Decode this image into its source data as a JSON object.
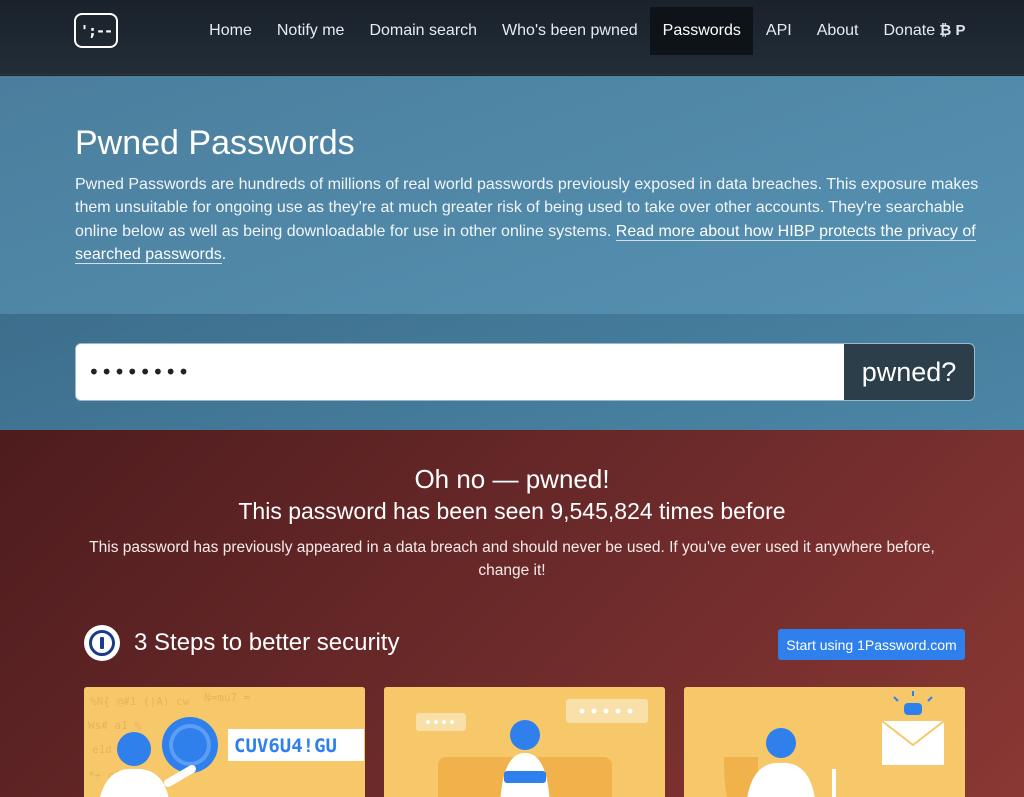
{
  "nav": {
    "logo_text": "';--",
    "items": [
      {
        "label": "Home"
      },
      {
        "label": "Notify me"
      },
      {
        "label": "Domain search"
      },
      {
        "label": "Who's been pwned"
      },
      {
        "label": "Passwords",
        "active": true
      },
      {
        "label": "API"
      },
      {
        "label": "About"
      },
      {
        "label": "Donate",
        "suffix": "₿ P"
      }
    ]
  },
  "hero": {
    "title": "Pwned Passwords",
    "text": "Pwned Passwords are hundreds of millions of real world passwords previously exposed in data breaches. This exposure makes them unsuitable for ongoing use as they're at much greater risk of being used to take over other accounts. They're searchable online below as well as being downloadable for use in other online systems. ",
    "link": "Read more about how HIBP protects the privacy of searched passwords",
    "trailing": "."
  },
  "search": {
    "value": "••••••••",
    "button_label": "pwned?"
  },
  "result": {
    "title": "Oh no — pwned!",
    "count_text": "This password has been seen 9,545,824 times before",
    "message": "This password has previously appeared in a data breach and should never be used. If you've ever used it anywhere before, change it!"
  },
  "steps": {
    "title": "3 Steps to better security",
    "cta_label": "Start using 1Password.com",
    "card1_text": "CUV6U4!GU"
  },
  "colors": {
    "result_bg": "#6e2b2b",
    "hero_bg": "#5692b3",
    "cta": "#2f80ed",
    "card": "#f7c86a"
  }
}
